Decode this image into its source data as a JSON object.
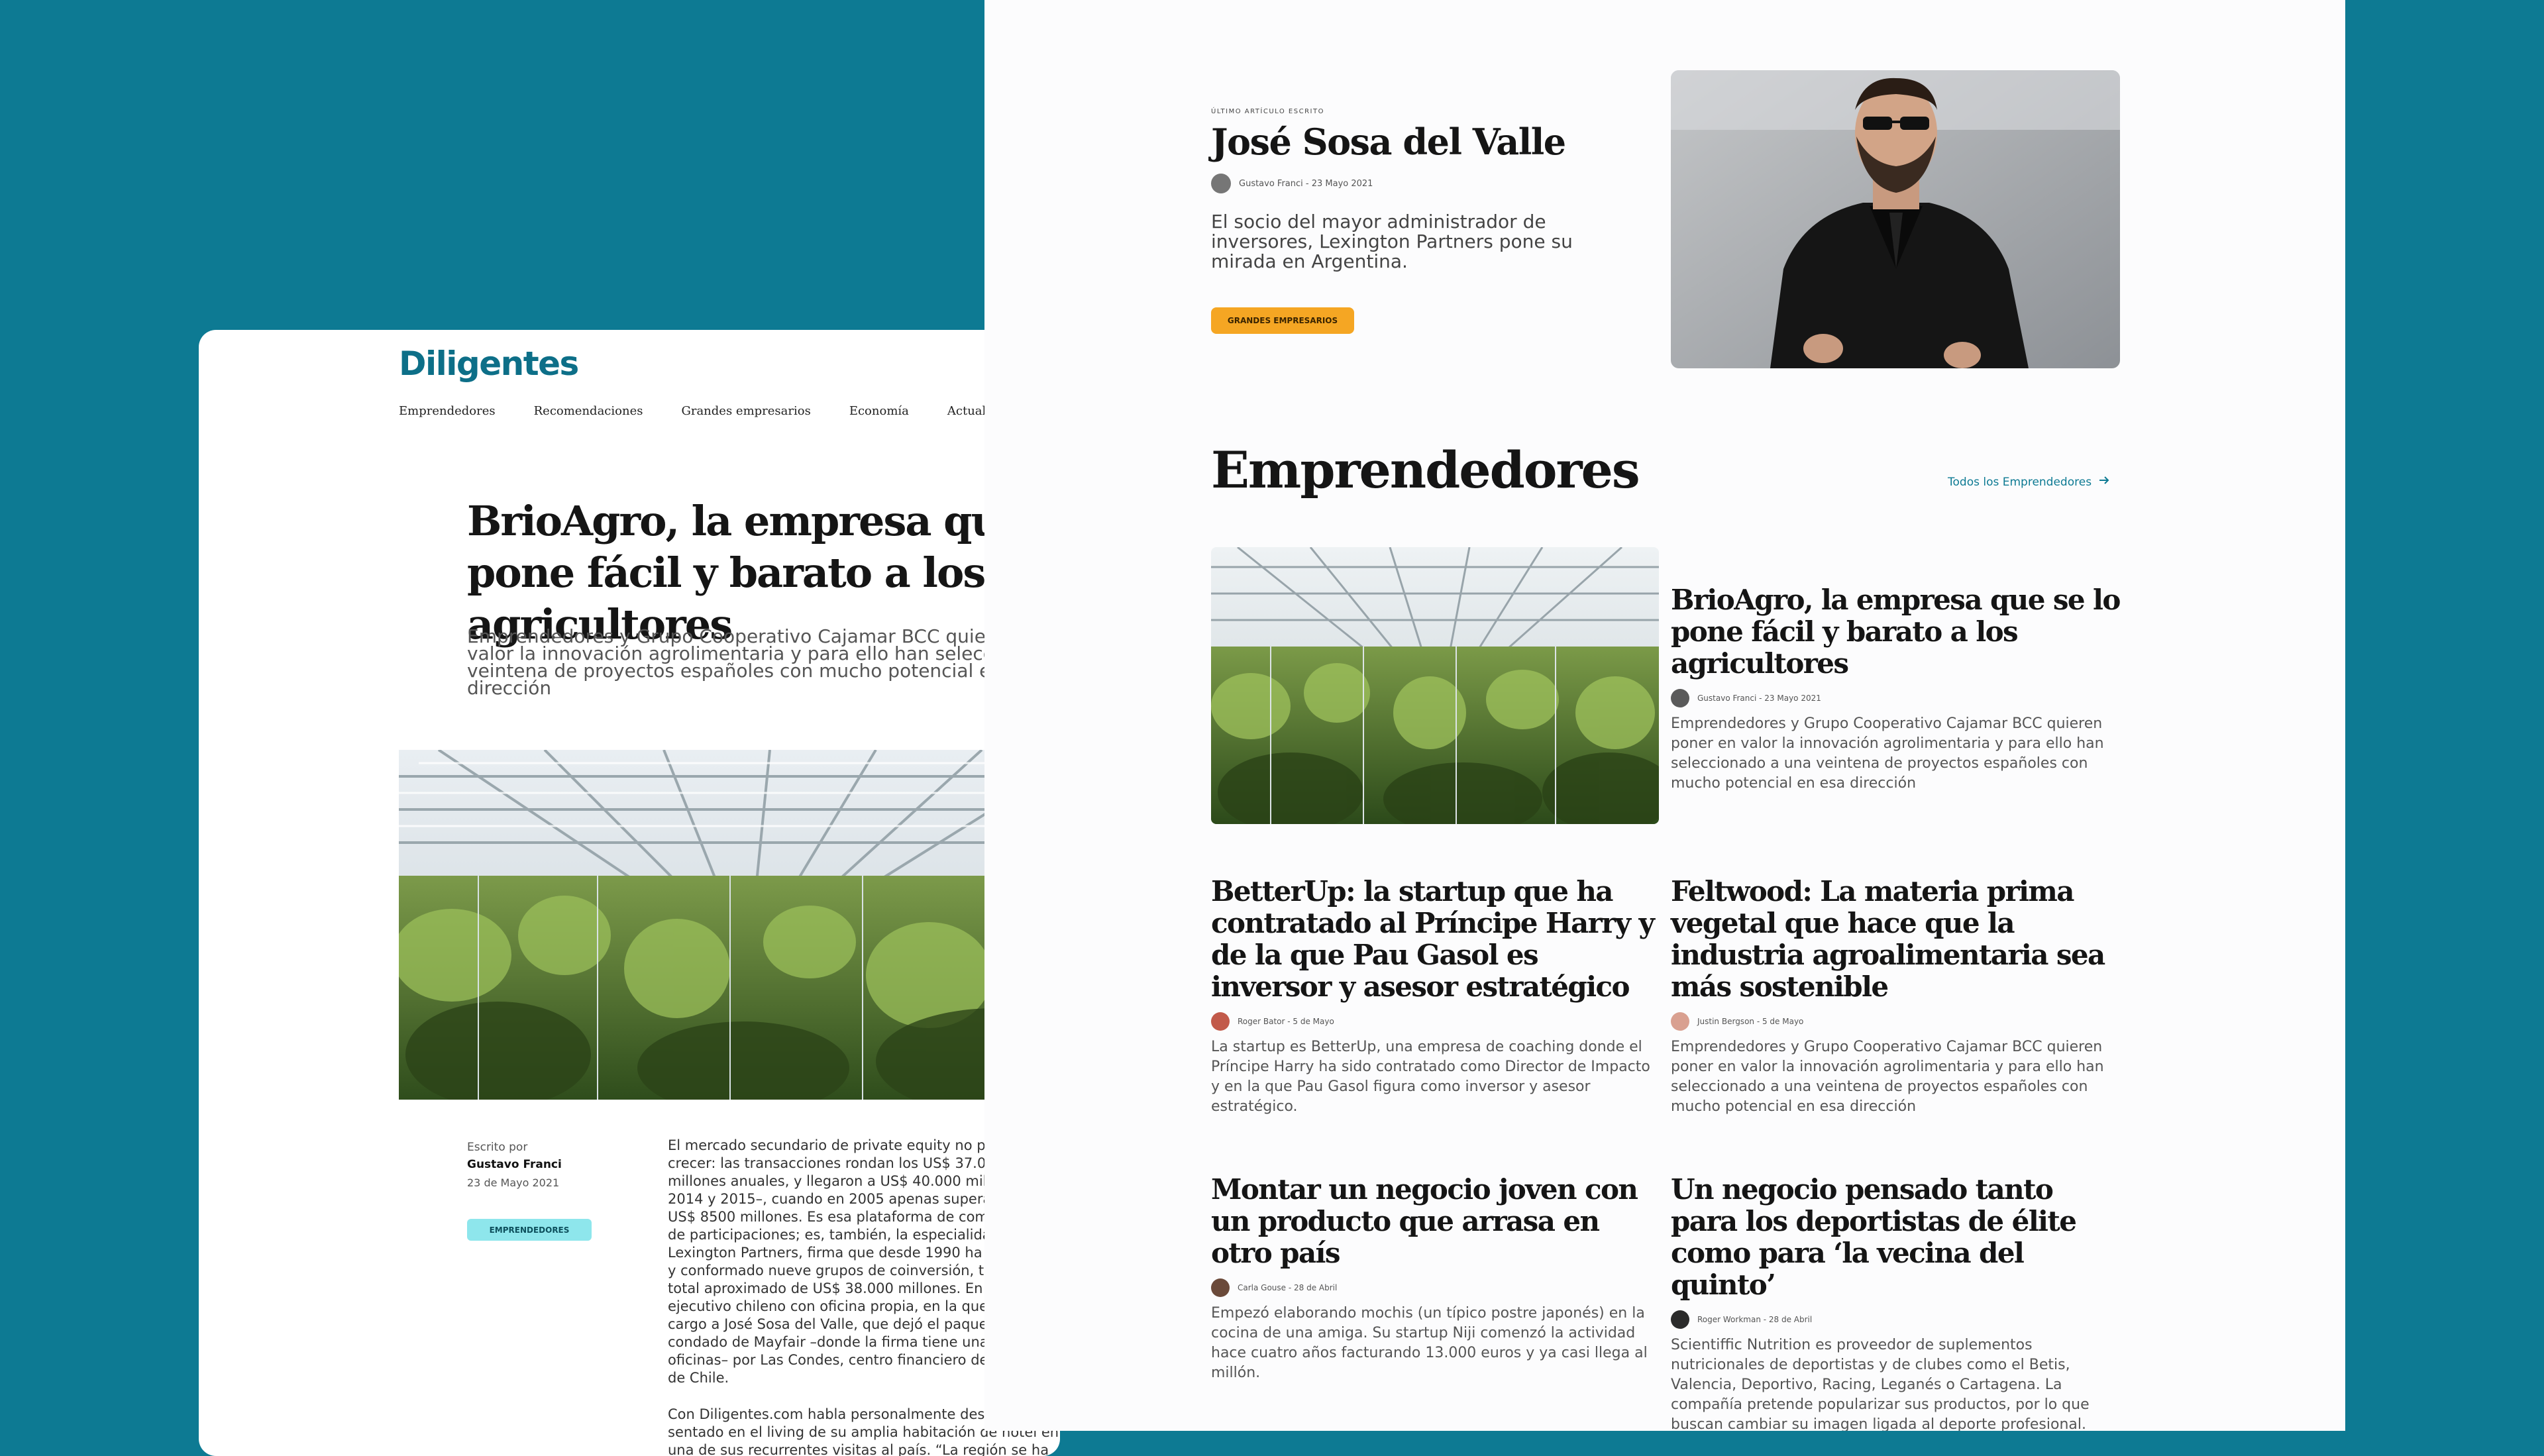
{
  "left_page": {
    "logo": "Diligentes",
    "nav": [
      "Emprendedores",
      "Recomendaciones",
      "Grandes empresarios",
      "Economía",
      "Actualidad Em"
    ],
    "article": {
      "title": "BrioAgro, la empresa que se lo pone fácil y barato a los agricultores",
      "subtitle": "Emprendedores y Grupo Cooperativo Cajamar BCC quieren poner en valor la innovación agrolimentaria y para ello han seleccionado a una veintena de proyectos españoles con mucho potencial en esa dirección",
      "written_by": "Escrito por",
      "author": "Gustavo Franci",
      "date": "23 de Mayo 2021",
      "category": "EMPRENDEDORES",
      "body_p1": "El mercado secundario de private equity no para de crecer: las transacciones rondan los US$ 37.000 millones anuales, y llegaron a US$ 40.000 millones en 2014 y 2015–, cuando en 2005 apenas superaban los US$ 8500 millones. Es esa plataforma de compra venta de participaciones; es, también, la especialidad de Lexington Partners, firma que desde 1990 ha levantado y conformado nueve grupos de coinversión, todo por un total aproximado de US$ 38.000 millones. En 2016, el ejecutivo chileno con oficina propia, en la que pusieron a cargo a José Sosa del Valle, que dejó el paquete condado de Mayfair –donde la firma tiene una de sus oficinas– por Las Condes, centro financiero de Santiago de Chile.",
      "body_p2": "Con Diligentes.com habla personalmente desde Chile, sentado en el living de su amplia habitación de hotel en una de sus recurrentes visitas al país. “La región se ha diversificado, hay bloques económicos que comienzan a tomar más"
    }
  },
  "right_page": {
    "latest": {
      "eyebrow": "ÚLTIMO ARTÍCULO ESCRITO",
      "title": "José Sosa del Valle",
      "meta": "Gustavo Franci - 23 Mayo 2021",
      "description": "El socio del mayor administrador de inversores, Lexington Partners pone su mirada en Argentina.",
      "category": "GRANDES EMPRESARIOS"
    },
    "section": {
      "title": "Emprendedores",
      "see_all": "Todos los Emprendedores"
    },
    "articles": [
      {
        "title": "BrioAgro, la empresa que se lo pone fácil y barato a los agricultores",
        "meta": "Gustavo Franci - 23 Mayo 2021",
        "excerpt": "Emprendedores y Grupo Cooperativo Cajamar BCC quieren poner en valor la innovación agrolimentaria y para ello han seleccionado a una veintena de proyectos españoles con mucho potencial en esa dirección",
        "avatar_color": "#5a5a5a"
      },
      {
        "title": "BetterUp: la startup que ha contratado al Príncipe Harry y de la que Pau Gasol es inversor y asesor estratégico",
        "meta": "Roger Bator - 5 de Mayo",
        "excerpt": "La startup es BetterUp, una empresa de coaching donde el Príncipe Harry ha sido contratado como Director de Impacto y en la que Pau Gasol figura como inversor y asesor estratégico.",
        "avatar_color": "#c25a4a"
      },
      {
        "title": "Feltwood: La materia prima vegetal que hace que la industria agroalimentaria sea más sostenible",
        "meta": "Justin Bergson - 5 de Mayo",
        "excerpt": "Emprendedores y Grupo Cooperativo Cajamar BCC quieren poner en valor la innovación agrolimentaria y para ello han seleccionado a una veintena de proyectos españoles con mucho potencial en esa dirección",
        "avatar_color": "#d9a090"
      },
      {
        "title": "Montar un negocio joven con un producto que arrasa en otro país",
        "meta": "Carla Gouse - 28 de Abril",
        "excerpt": "Empezó elaborando mochis (un típico postre japonés) en la cocina de una amiga. Su startup Niji comenzó la actividad hace cuatro años facturando 13.000 euros y ya casi llega al millón.",
        "avatar_color": "#6b4a3a"
      },
      {
        "title": "Un negocio pensado tanto para los deportistas de élite como para ‘la vecina del quinto’",
        "meta": "Roger Workman - 28 de Abril",
        "excerpt": "Scientiffic Nutrition es proveedor de suplementos nutricionales de deportistas y de clubes como el Betis, Valencia, Deportivo, Racing, Leganés o Cartagena. La compañía pretende popularizar sus productos, por lo que buscan cambiar su imagen ligada al deporte profesional.",
        "avatar_color": "#2b2b2b"
      }
    ]
  },
  "colors": {
    "background": "#0d7a93",
    "brand": "#0d6f88",
    "pill_cyan": "#8ee6ec",
    "pill_orange": "#f5a623"
  }
}
